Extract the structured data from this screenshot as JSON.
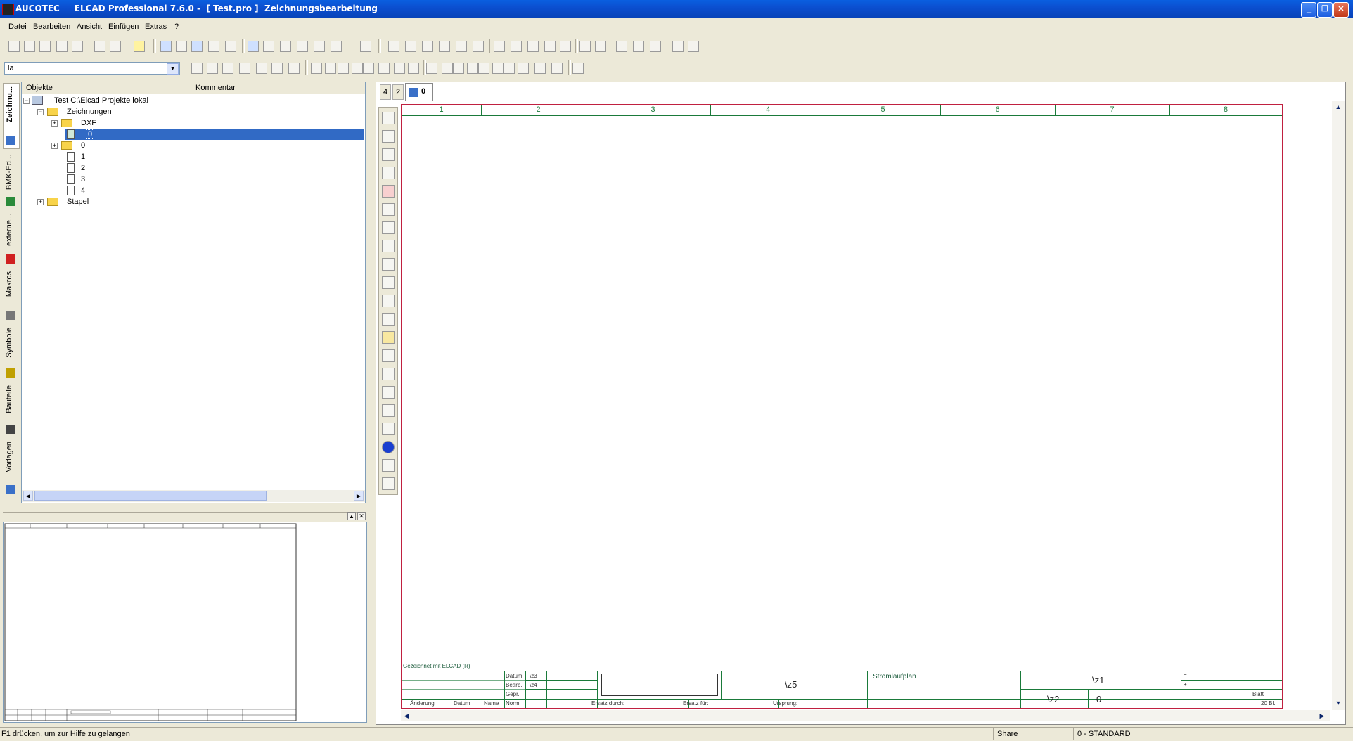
{
  "window": {
    "title": "AUCOTEC     ELCAD Professional 7.6.0 -  [ Test.pro ]  Zeichnungsbearbeitung",
    "minimize": "_",
    "maximize": "❐",
    "close": "✕"
  },
  "menu": [
    "Datei",
    "Bearbeiten",
    "Ansicht",
    "Einfügen",
    "Extras",
    "?"
  ],
  "toolbar": {
    "combo_value": "la"
  },
  "vtabs": [
    "Zeichnu...",
    "BMK-Ed...",
    "externe...",
    "Makros",
    "Symbole",
    "Bauteile",
    "Vorlagen"
  ],
  "tree": {
    "col_objects": "Objekte",
    "col_comment": "Kommentar",
    "root": "Test C:\\Elcad Projekte lokal",
    "zeichnungen": "Zeichnungen",
    "dxf": "DXF",
    "item_selected": "0",
    "folder_0": "0",
    "items": [
      "1",
      "2",
      "3",
      "4"
    ],
    "stapel": "Stapel"
  },
  "doc_tabs": [
    "4",
    "2",
    "0"
  ],
  "sheet": {
    "columns": [
      "1",
      "2",
      "3",
      "4",
      "5",
      "6",
      "7",
      "8"
    ],
    "drawn_with": "Gezeichnet mit ELCAD (R)",
    "labels": {
      "datum": "Datum",
      "bearb": "Bearb.",
      "gepr": "Gepr.",
      "norm": "Norm",
      "aenderung": "Änderung",
      "datum2": "Datum",
      "name": "Name",
      "ersatz_durch": "Ersatz durch:",
      "ersatz_fuer": "Ersatz für:",
      "ursprung": "Ursprung:",
      "blatt": "Blatt",
      "bl": "20  Bl.",
      "eq": "=",
      "plus": "+"
    },
    "z3": "\\z3",
    "z4": "\\z4",
    "z5": "\\z5",
    "z1": "\\z1",
    "z2": "\\z2",
    "type": "Stromlaufplan",
    "sheet_no": "0  -"
  },
  "status": {
    "help": "F1 drücken, um zur Hilfe zu gelangen",
    "share": "Share",
    "layer": "0 - STANDARD"
  }
}
